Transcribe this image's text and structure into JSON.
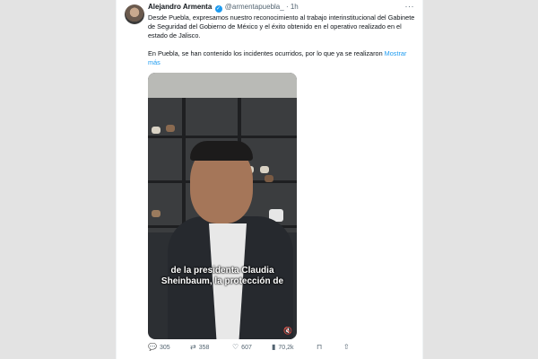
{
  "tweet": {
    "author_name": "Alejandro Armenta",
    "handle": "@armentapuebla_",
    "separator": "·",
    "time": "1h",
    "paragraph_1": "Desde Puebla, expresamos nuestro reconocimiento al trabajo interinstitucional del Gabinete de Seguridad del Gobierno de México y el éxito obtenido en el operativo realizado en el estado de Jalisco.",
    "paragraph_2": "En Puebla, se han contenido los incidentes ocurridos, por lo que ya se realizaron",
    "show_more": "Mostrar más",
    "video_caption": "de la presidenta Claudia Sheinbaum, la protección de"
  },
  "actions": {
    "replies": "305",
    "reposts": "358",
    "likes": "607",
    "views": "70,2k"
  },
  "icons": {
    "verified": "verified-badge-icon",
    "more": "more-options-icon",
    "reply": "reply-icon",
    "repost": "repost-icon",
    "like": "heart-icon",
    "views": "views-icon",
    "bookmark": "bookmark-icon",
    "share": "share-icon",
    "mute": "mute-icon"
  },
  "colors": {
    "accent": "#1d9bf0",
    "text": "#0f1419",
    "secondary": "#536471"
  }
}
